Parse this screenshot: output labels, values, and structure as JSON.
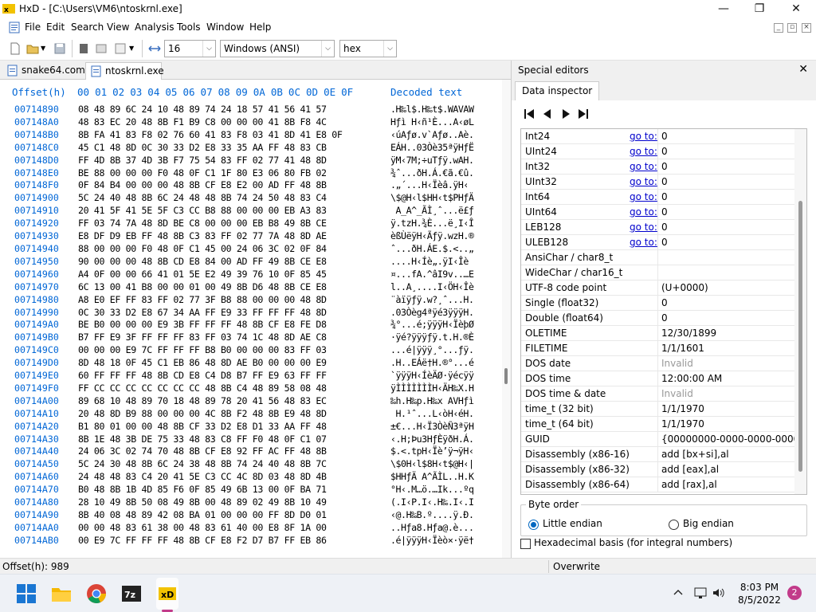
{
  "window": {
    "title": "HxD - [C:\\Users\\VM6\\ntoskrnl.exe]",
    "minimize": "—",
    "maximize": "❐",
    "close": "✕"
  },
  "menu": [
    "File",
    "Edit",
    "Search",
    "View",
    "Analysis",
    "Tools",
    "Window",
    "Help"
  ],
  "toolbar": {
    "bytes_per_row": "16",
    "charset": "Windows (ANSI)",
    "display": "hex"
  },
  "tabs": [
    {
      "label": "snake64.com",
      "active": false
    },
    {
      "label": "ntoskrnl.exe",
      "active": true
    }
  ],
  "hex": {
    "header_offset": "Offset(h)",
    "header_columns": "00 01 02 03 04 05 06 07 08 09 0A 0B 0C 0D 0E 0F",
    "header_decoded": "Decoded text",
    "rows": [
      {
        "offset": "00714890",
        "bytes": "08 48 89 6C 24 10 48 89 74 24 18 57 41 56 41 57",
        "text": ".H‰l$.H‰t$.WAVAW"
      },
      {
        "offset": "007148A0",
        "bytes": "48 83 EC 20 48 8B F1 B9 C8 00 00 00 41 8B F8 4C",
        "text": "Hƒì H‹ñ¹È...A‹øL"
      },
      {
        "offset": "007148B0",
        "bytes": "8B FA 41 83 F8 02 76 60 41 83 F8 03 41 8D 41 E8 0F",
        "text": "‹úAƒø.v`Aƒø..Aè."
      },
      {
        "offset": "007148C0",
        "bytes": "45 C1 48 8D 0C 30 33 D2 E8 33 35 AA FF 48 83 CB",
        "text": "EÁH..03Òè35ªÿHƒË"
      },
      {
        "offset": "007148D0",
        "bytes": "FF 4D 8B 37 4D 3B F7 75 54 83 FF 02 77 41 48 8D",
        "text": "ÿM‹7M;÷uTƒÿ.wAH."
      },
      {
        "offset": "007148E0",
        "bytes": "BE 88 00 00 00 F0 48 0F C1 1F 80 E3 06 80 FB 02",
        "text": "¾ˆ...ðH.Á.€ã.€û."
      },
      {
        "offset": "007148F0",
        "bytes": "0F 84 B4 00 00 00 48 8B CF E8 E2 00 AD FF 48 8B",
        "text": ".„´...H‹Ïèâ.­ÿH‹"
      },
      {
        "offset": "00714900",
        "bytes": "5C 24 40 48 8B 6C 24 48 48 8B 74 24 50 48 83 C4",
        "text": "\\$@H‹l$HH‹t$PHƒÄ"
      },
      {
        "offset": "00714910",
        "bytes": "20 41 5F 41 5E 5F C3 CC B8 88 00 00 00 EB A3 83",
        "text": " A_A^_ÃÌ¸ˆ...ë£ƒ"
      },
      {
        "offset": "00714920",
        "bytes": "FF 03 74 7A 48 8D BE C8 00 00 00 EB B8 49 8B CE",
        "text": "ÿ.tzH.¾È...ë¸I‹Î"
      },
      {
        "offset": "00714930",
        "bytes": "E8 DF D9 EB FF 48 8B C3 83 FF 02 77 7A 48 8D AE",
        "text": "èßÙëÿH‹Ãƒÿ.wzH.®"
      },
      {
        "offset": "00714940",
        "bytes": "88 00 00 00 F0 48 0F C1 45 00 24 06 3C 02 0F 84",
        "text": "ˆ...ðH.ÁE.$.<..„"
      },
      {
        "offset": "00714950",
        "bytes": "90 00 00 00 48 8B CD E8 84 00 AD FF 49 8B CE E8",
        "text": "....H‹Íè„.­ÿI‹Îè"
      },
      {
        "offset": "00714960",
        "bytes": "A4 0F 00 00 66 41 01 5E E2 49 39 76 10 0F 85 45",
        "text": "¤...fA.^âI9v..…E"
      },
      {
        "offset": "00714970",
        "bytes": "6C 13 00 41 B8 00 00 01 00 49 8B D6 48 8B CE E8",
        "text": "l..A¸....I‹ÖH‹Îè"
      },
      {
        "offset": "00714980",
        "bytes": "A8 E0 EF FF 83 FF 02 77 3F B8 88 00 00 00 48 8D",
        "text": "¨àïÿƒÿ.w?¸ˆ...H."
      },
      {
        "offset": "00714990",
        "bytes": "0C 30 33 D2 E8 67 34 AA FF E9 33 FF FF FF 48 8D",
        "text": ".03Òèg4ªÿé3ÿÿÿH."
      },
      {
        "offset": "007149A0",
        "bytes": "BE B0 00 00 00 E9 3B FF FF FF 48 8B CF E8 FE D8",
        "text": "¾°...é;ÿÿÿH‹ÏèþØ"
      },
      {
        "offset": "007149B0",
        "bytes": "B7 FF E9 3F FF FF FF 83 FF 03 74 1C 48 8D AE C8",
        "text": "·ÿé?ÿÿÿƒÿ.t.H.®È"
      },
      {
        "offset": "007149C0",
        "bytes": "00 00 00 E9 7C FF FF FF B8 B0 00 00 00 83 FF 03",
        "text": "...é|ÿÿÿ¸°...ƒÿ."
      },
      {
        "offset": "007149D0",
        "bytes": "8D 48 18 0F 45 C1 EB 86 48 8D AE B0 00 00 00 E9",
        "text": ".H..EÁë†H.®°...é"
      },
      {
        "offset": "007149E0",
        "bytes": "60 FF FF FF 48 8B CD E8 C4 D8 B7 FF E9 63 FF FF",
        "text": "`ÿÿÿH‹ÍèÄØ·ÿécÿÿ"
      },
      {
        "offset": "007149F0",
        "bytes": "FF CC CC CC CC CC CC CC 48 8B C4 48 89 58 08 48",
        "text": "ÿÌÌÌÌÌÌÌH‹ÄH‰X.H"
      },
      {
        "offset": "00714A00",
        "bytes": "89 68 10 48 89 70 18 48 89 78 20 41 56 48 83 EC",
        "text": "‰h.H‰p.H‰x AVHƒì"
      },
      {
        "offset": "00714A10",
        "bytes": "20 48 8D B9 88 00 00 00 4C 8B F2 48 8B E9 48 8D",
        "text": " H.¹ˆ...L‹òH‹éH."
      },
      {
        "offset": "00714A20",
        "bytes": "B1 80 01 00 00 48 8B CF 33 D2 E8 D1 33 AA FF 48",
        "text": "±€...H‹Ï3ÒèÑ3ªÿH"
      },
      {
        "offset": "00714A30",
        "bytes": "8B 1E 48 3B DE 75 33 48 83 C8 FF F0 48 0F C1 07",
        "text": "‹.H;Þu3HƒÈÿðH.Á."
      },
      {
        "offset": "00714A40",
        "bytes": "24 06 3C 02 74 70 48 8B CF E8 92 FF AC FF 48 8B",
        "text": "$.<.tpH‹Ïè’ÿ¬ÿH‹"
      },
      {
        "offset": "00714A50",
        "bytes": "5C 24 30 48 8B 6C 24 38 48 8B 74 24 40 48 8B 7C",
        "text": "\\$0H‹l$8H‹t$@H‹|"
      },
      {
        "offset": "00714A60",
        "bytes": "24 48 48 83 C4 20 41 5E C3 CC 4C 8D 03 48 8D 4B",
        "text": "$HHƒÄ A^ÃÌL..H.K"
      },
      {
        "offset": "00714A70",
        "bytes": "B0 48 8B 1B 4D 85 F6 0F 85 49 6B 13 00 0F BA 71",
        "text": "°H‹.M…ö.…Ik...ºq"
      },
      {
        "offset": "00714A80",
        "bytes": "28 10 49 8B 50 08 49 8B 00 48 89 02 49 8B 10 49",
        "text": "(.I‹P.I‹.H‰.I‹.I"
      },
      {
        "offset": "00714A90",
        "bytes": "8B 40 08 48 89 42 08 BA 01 00 00 00 FF 8D D0 01",
        "text": "‹@.H‰B.º....ÿ.Ð."
      },
      {
        "offset": "00714AA0",
        "bytes": "00 00 48 83 61 38 00 48 83 61 40 00 E8 8F 1A 00",
        "text": "..Hƒa8.Hƒa@.è..."
      },
      {
        "offset": "00714AB0",
        "bytes": "00 E9 7C FF FF FF 48 8B CF E8 F2 D7 B7 FF EB 86",
        "text": ".é|ÿÿÿH‹Ïèò×·ÿë†"
      }
    ]
  },
  "special_editors": {
    "title": "Special editors",
    "close": "✕",
    "tab": "Data inspector",
    "goto_label": "go to:",
    "rows": [
      {
        "name": "Int24",
        "goto": true,
        "value": "0",
        "muted": false
      },
      {
        "name": "UInt24",
        "goto": true,
        "value": "0",
        "muted": false
      },
      {
        "name": "Int32",
        "goto": true,
        "value": "0",
        "muted": false
      },
      {
        "name": "UInt32",
        "goto": true,
        "value": "0",
        "muted": false
      },
      {
        "name": "Int64",
        "goto": true,
        "value": "0",
        "muted": false
      },
      {
        "name": "UInt64",
        "goto": true,
        "value": "0",
        "muted": false
      },
      {
        "name": "LEB128",
        "goto": true,
        "value": "0",
        "muted": false
      },
      {
        "name": "ULEB128",
        "goto": true,
        "value": "0",
        "muted": false
      },
      {
        "name": "AnsiChar / char8_t",
        "goto": false,
        "value": "",
        "muted": false
      },
      {
        "name": "WideChar / char16_t",
        "goto": false,
        "value": "",
        "muted": false
      },
      {
        "name": "UTF-8 code point",
        "goto": false,
        "value": "  (U+0000)",
        "muted": false
      },
      {
        "name": "Single (float32)",
        "goto": false,
        "value": "0",
        "muted": false
      },
      {
        "name": "Double (float64)",
        "goto": false,
        "value": "0",
        "muted": false
      },
      {
        "name": "OLETIME",
        "goto": false,
        "value": "12/30/1899",
        "muted": false
      },
      {
        "name": "FILETIME",
        "goto": false,
        "value": "1/1/1601",
        "muted": false
      },
      {
        "name": "DOS date",
        "goto": false,
        "value": "Invalid",
        "muted": true
      },
      {
        "name": "DOS time",
        "goto": false,
        "value": "12:00:00 AM",
        "muted": false
      },
      {
        "name": "DOS time & date",
        "goto": false,
        "value": "Invalid",
        "muted": true
      },
      {
        "name": "time_t (32 bit)",
        "goto": false,
        "value": "1/1/1970",
        "muted": false
      },
      {
        "name": "time_t (64 bit)",
        "goto": false,
        "value": "1/1/1970",
        "muted": false
      },
      {
        "name": "GUID",
        "goto": false,
        "value": "{00000000-0000-0000-0000-000000000000}",
        "muted": false
      },
      {
        "name": "Disassembly (x86-16)",
        "goto": false,
        "value": "add [bx+si],al",
        "muted": false
      },
      {
        "name": "Disassembly (x86-32)",
        "goto": false,
        "value": "add [eax],al",
        "muted": false
      },
      {
        "name": "Disassembly (x86-64)",
        "goto": false,
        "value": "add [rax],al",
        "muted": false
      }
    ],
    "byte_order_label": "Byte order",
    "little_endian": "Little endian",
    "big_endian": "Big endian",
    "selected_byte_order": "little",
    "hex_basis_label": "Hexadecimal basis (for integral numbers)",
    "hex_basis_checked": false
  },
  "status": {
    "offset": "Offset(h): 989",
    "mode": "Overwrite"
  },
  "taskbar": {
    "apps": [
      "start-icon",
      "file-explorer-icon",
      "chrome-icon",
      "7zip-icon",
      "hxd-icon"
    ],
    "time": "8:03 PM",
    "date": "8/5/2022",
    "notifications": "2"
  },
  "colors": {
    "offset_blue": "#0066d6",
    "link_blue": "#0000cc",
    "accent": "#0067c0",
    "notification": "#c23b8a"
  }
}
